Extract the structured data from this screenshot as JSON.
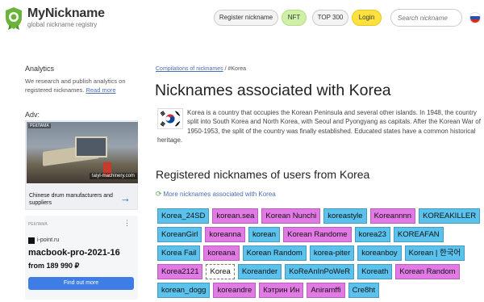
{
  "header": {
    "logo_name": "MyNickname",
    "logo_sub": "global nickname registry",
    "register_label": "Register nickname",
    "nft_label": "NFT",
    "top_label": "TOP 300",
    "login_label": "Login",
    "search_placeholder": "Search nickname",
    "language_icon": "flag-ru-icon"
  },
  "sidebar": {
    "analytics_title": "Analytics",
    "analytics_text": "We research and publish analytics on registered nicknames.",
    "analytics_link": "Read more",
    "adv_label": "Adv:",
    "ad1": {
      "tag": "РЕКЛАМА",
      "site": "taiyl-machinery.com",
      "text": "Chinese drum manufacturers and suppliers",
      "arrow": "→"
    },
    "ad2": {
      "tag": "РЕКЛАМА",
      "menu": "⋮",
      "domain": "i-point.ru",
      "title": "macbook-pro-2021-16",
      "price": "from 189 990 ₽",
      "button": "Find out more"
    }
  },
  "main": {
    "breadcrumb_link": "Compilations of nicknames",
    "breadcrumb_current": " / #Korea",
    "title": "Nicknames associated with Korea",
    "description": "Korea is a country that occupies the Korean Peninsula and several other islands. In 1948, the country split into South Korea and North Korea, with Seoul and Pyongyang as capitals. After the Korean War of 1950-1953, the split of the country was finally established. Educated states have a common historical heritage.",
    "registered_title": "Registered nicknames of users from Korea",
    "more_link": "More nicknames associated with Korea",
    "nicknames": [
      {
        "name": "Korea_24SD",
        "c": "b"
      },
      {
        "name": "korean.sea",
        "c": "p"
      },
      {
        "name": "Korean Nunchi",
        "c": "p"
      },
      {
        "name": "koreastyle",
        "c": "b"
      },
      {
        "name": "Koreannnn",
        "c": "p"
      },
      {
        "name": "KOREAKILLER",
        "c": "b"
      },
      {
        "name": "KoreanGirl",
        "c": "b"
      },
      {
        "name": "koreanna",
        "c": "p"
      },
      {
        "name": "korean",
        "c": "b"
      },
      {
        "name": "Korean Randome",
        "c": "p"
      },
      {
        "name": "korea23",
        "c": "b"
      },
      {
        "name": "KOREAFAN",
        "c": "b"
      },
      {
        "name": "Korea Fail",
        "c": "b"
      },
      {
        "name": "koreana",
        "c": "p"
      },
      {
        "name": "Korean Random",
        "c": "b"
      },
      {
        "name": "korea-piter",
        "c": "b"
      },
      {
        "name": "koreanboy",
        "c": "b"
      },
      {
        "name": "Korean | 한국어",
        "c": "b"
      },
      {
        "name": "Korea2121",
        "c": "p"
      },
      {
        "name": "Korea",
        "c": "w"
      },
      {
        "name": "Koreander",
        "c": "b"
      },
      {
        "name": "KoReAnInPoWeR",
        "c": "b"
      },
      {
        "name": "Koreath",
        "c": "b"
      },
      {
        "name": "Korean Random",
        "c": "p"
      },
      {
        "name": "korean_dogg",
        "c": "b"
      },
      {
        "name": "koreandre",
        "c": "p"
      },
      {
        "name": "Кэтрин Ин",
        "c": "p"
      },
      {
        "name": "Aniramffi",
        "c": "p"
      },
      {
        "name": "Cre8ht",
        "c": "b"
      }
    ]
  },
  "colors": {
    "nick_blue": "#5ac2ec",
    "nick_pink": "#e27ae6",
    "nft": "#cef0a7",
    "login": "#fde13f",
    "link": "#4a6db5"
  }
}
